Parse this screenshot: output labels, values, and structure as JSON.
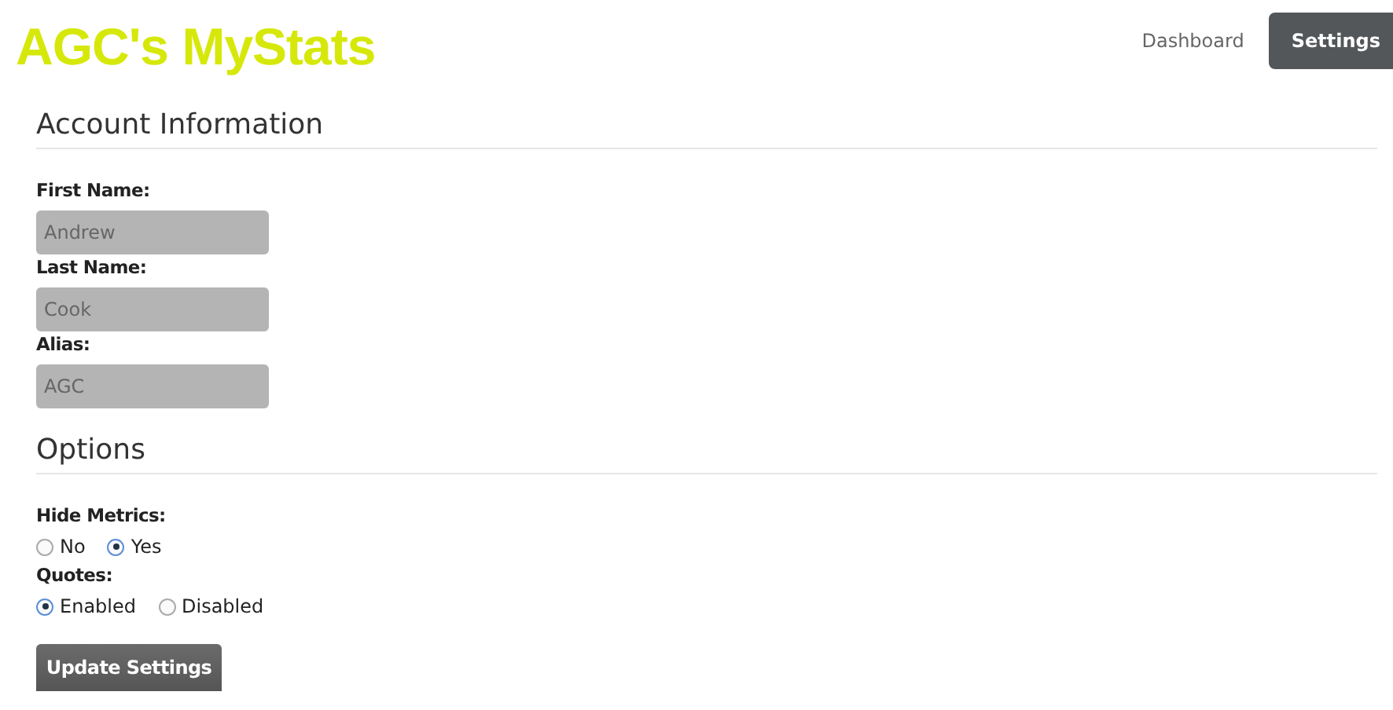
{
  "brand": "AGC's MyStats",
  "nav": [
    {
      "label": "Dashboard",
      "selected": false
    },
    {
      "label": "Settings",
      "selected": true
    }
  ],
  "account": {
    "title": "Account Information",
    "fields": [
      {
        "label": "First Name:",
        "value": "Andrew"
      },
      {
        "label": "Last Name:",
        "value": "Cook"
      },
      {
        "label": "Alias:",
        "value": "AGC"
      }
    ]
  },
  "options": {
    "title": "Options",
    "groups": [
      {
        "label": "Hide Metrics:",
        "choices": [
          {
            "label": "No",
            "selected": false
          },
          {
            "label": "Yes",
            "selected": true
          }
        ]
      },
      {
        "label": "Quotes:",
        "choices": [
          {
            "label": "Enabled",
            "selected": true
          },
          {
            "label": "Disabled",
            "selected": false
          }
        ]
      }
    ]
  },
  "submit": "Update Settings"
}
